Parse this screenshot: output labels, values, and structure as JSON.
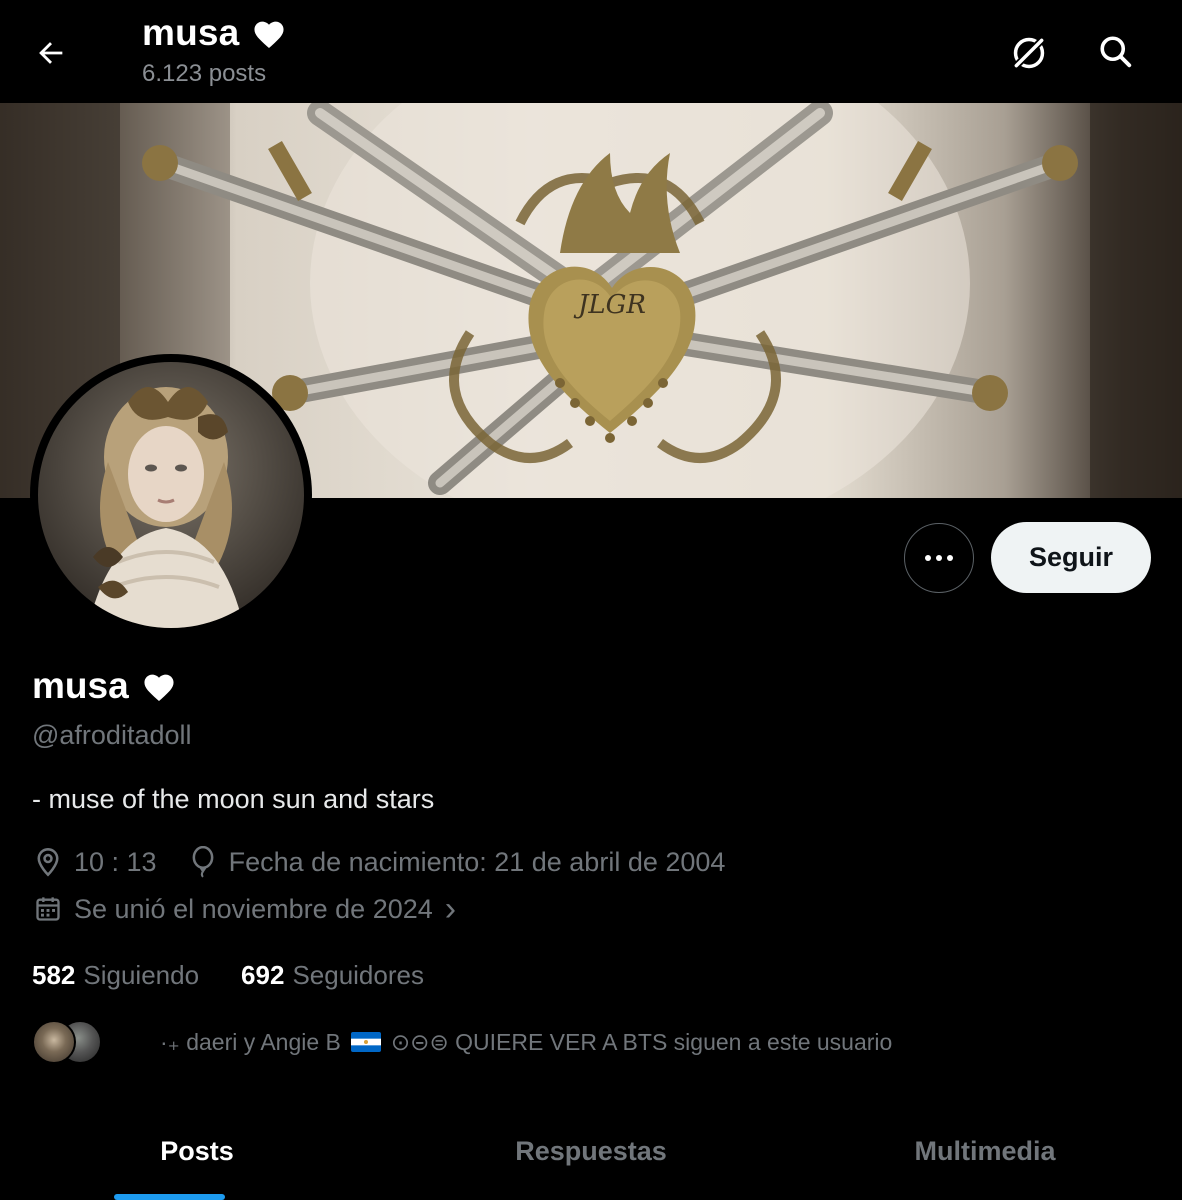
{
  "header": {
    "title": "musa",
    "title_emoji": "♥",
    "post_count": "6.123 posts"
  },
  "profile": {
    "name": "musa",
    "name_emoji": "♥",
    "handle": "@afroditadoll",
    "bio": "- muse of the moon sun and stars",
    "location": "10 : 13",
    "birthday": "Fecha de nacimiento: 21 de abril de 2004",
    "joined": "Se unió el noviembre de 2024",
    "joined_chevron": "›"
  },
  "actions": {
    "follow_label": "Seguir"
  },
  "stats": {
    "following_count": "582",
    "following_label": "Siguiendo",
    "followers_count": "692",
    "followers_label": "Seguidores"
  },
  "known_followers": {
    "text_before_flag": "·₊ daeri y Angie B",
    "text_after_flag": "⊙⊝⊜ QUIERE VER A BTS siguen a este usuario"
  },
  "tabs": [
    {
      "label": "Posts",
      "active": true
    },
    {
      "label": "Respuestas",
      "active": false
    },
    {
      "label": "Multimedia",
      "active": false
    }
  ],
  "colors": {
    "accent": "#1d9bf0",
    "muted_text": "#71767b",
    "background": "#000000",
    "follow_button_bg": "#eff3f4"
  },
  "icons": {
    "back": "arrow-left-icon",
    "grok": "grok-icon",
    "search": "search-icon",
    "location": "location-pin-icon",
    "birthday": "balloon-icon",
    "joined": "calendar-icon",
    "more": "more-dots-icon"
  }
}
